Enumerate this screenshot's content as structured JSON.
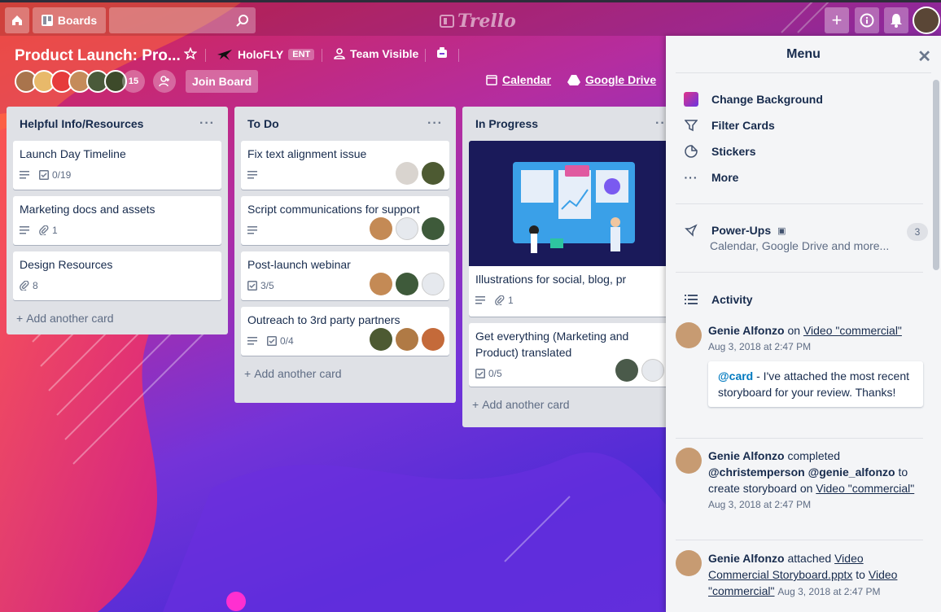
{
  "topbar": {
    "boards_label": "Boards",
    "search_value": "",
    "logo_text": "Trello"
  },
  "board": {
    "title": "Product Launch: Pro...",
    "team": "HoloFLY",
    "team_badge": "ENT",
    "visibility": "Team Visible",
    "member_count": "15",
    "join_label": "Join Board",
    "calendar_label": "Calendar",
    "drive_label": "Google Drive"
  },
  "lists": [
    {
      "name": "Helpful Info/Resources",
      "cards": [
        {
          "title": "Launch Day Timeline",
          "checklist": "0/19"
        },
        {
          "title": "Marketing docs and assets",
          "attachments": "1"
        },
        {
          "title": "Design Resources",
          "attachments": "8"
        }
      ],
      "add_label": "Add another card"
    },
    {
      "name": "To Do",
      "cards": [
        {
          "title": "Fix text alignment issue"
        },
        {
          "title": "Script communications for support"
        },
        {
          "title": "Post-launch webinar",
          "checklist": "3/5"
        },
        {
          "title": "Outreach to 3rd party partners",
          "checklist": "0/4"
        }
      ],
      "add_label": "Add another card"
    },
    {
      "name": "In Progress",
      "cards": [
        {
          "title": "Illustrations for social, blog, pr",
          "attachments": "1"
        },
        {
          "title": "Get everything (Marketing and Product) translated",
          "checklist": "0/5"
        }
      ],
      "add_label": "Add another card"
    }
  ],
  "menu": {
    "title": "Menu",
    "items": [
      {
        "label": "Change Background",
        "icon": "background-swatch-icon"
      },
      {
        "label": "Filter Cards",
        "icon": "filter-icon"
      },
      {
        "label": "Stickers",
        "icon": "sticker-icon"
      },
      {
        "label": "More",
        "icon": "more-icon"
      }
    ],
    "powerups": {
      "label": "Power-Ups",
      "sub": "Calendar, Google Drive and more...",
      "count": "3"
    },
    "activity_label": "Activity",
    "activity": [
      {
        "user": "Genie Alfonzo",
        "pre": "on",
        "link": "Video \"commercial\"",
        "time": "Aug 3, 2018 at 2:47 PM",
        "comment_mention": "@card",
        "comment_text": " - I've attached the most recent storyboard for your review. Thanks!"
      },
      {
        "user": "Genie Alfonzo",
        "pre": "completed",
        "mention1": "@christemperson",
        "mention2": "@genie_alfonzo",
        "mid": "to create storyboard on",
        "link": "Video \"commercial\"",
        "time": "Aug 3, 2018 at 2:47 PM"
      },
      {
        "user": "Genie Alfonzo",
        "pre": "attached",
        "link": "Video Commercial Storyboard.pptx",
        "mid": "to",
        "link2": "Video \"commercial\"",
        "time": "Aug 3, 2018 at 2:47 PM"
      }
    ]
  },
  "colors": {
    "accent": "#0079bf",
    "list_bg": "#dfe1e6",
    "menu_bg": "#f4f5f7"
  }
}
